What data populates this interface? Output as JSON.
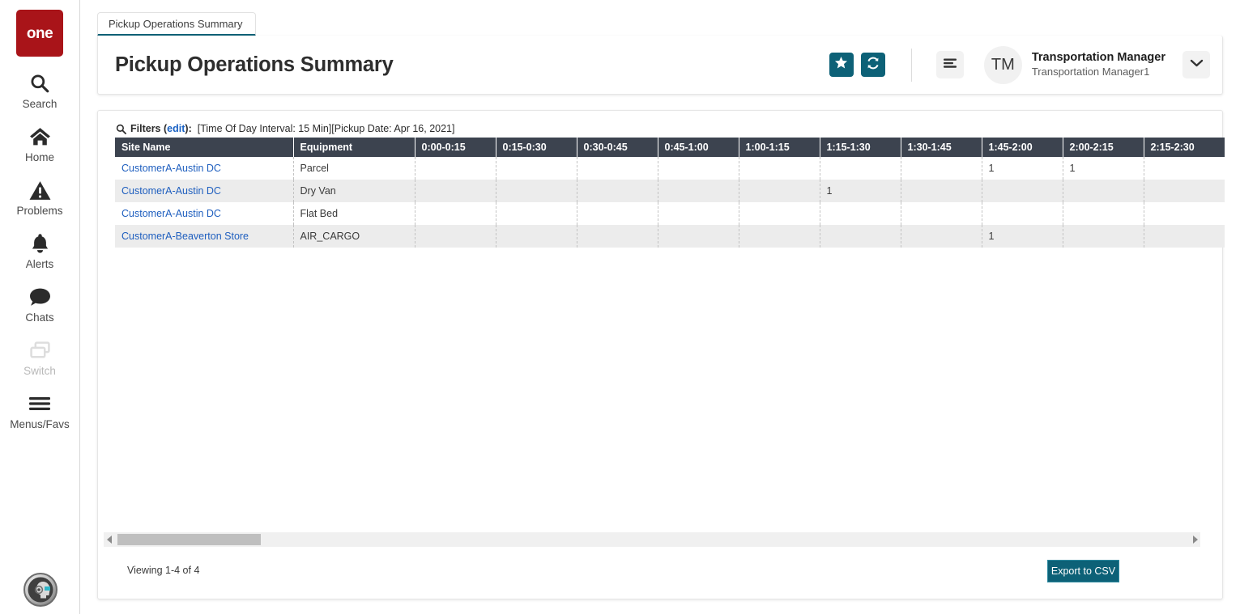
{
  "sidebar": {
    "logo_text": "one",
    "items": [
      {
        "label": "Search",
        "icon": "search-icon",
        "disabled": false
      },
      {
        "label": "Home",
        "icon": "home-icon",
        "disabled": false
      },
      {
        "label": "Problems",
        "icon": "warning-icon",
        "disabled": false
      },
      {
        "label": "Alerts",
        "icon": "bell-icon",
        "disabled": false
      },
      {
        "label": "Chats",
        "icon": "chat-icon",
        "disabled": false
      },
      {
        "label": "Switch",
        "icon": "switch-icon",
        "disabled": true
      },
      {
        "label": "Menus/Favs",
        "icon": "hamburger-icon",
        "disabled": false
      }
    ],
    "assistant_icon": "ai-assistant-avatar-icon"
  },
  "tab": {
    "label": "Pickup Operations Summary"
  },
  "header": {
    "title": "Pickup Operations Summary",
    "favorite_icon": "star-icon",
    "refresh_icon": "refresh-icon",
    "menu_icon": "hamburger-icon",
    "avatar_initials": "TM",
    "user_name": "Transportation Manager",
    "user_subtitle": "Transportation Manager1",
    "dropdown_icon": "chevron-down-icon"
  },
  "filters": {
    "icon": "search-icon",
    "label": "Filters",
    "edit_label": "edit",
    "colon": ":",
    "value": "[Time Of Day Interval: 15 Min][Pickup Date: Apr 16, 2021]"
  },
  "table": {
    "columns": [
      "Site Name",
      "Equipment",
      "0:00-0:15",
      "0:15-0:30",
      "0:30-0:45",
      "0:45-1:00",
      "1:00-1:15",
      "1:15-1:30",
      "1:30-1:45",
      "1:45-2:00",
      "2:00-2:15",
      "2:15-2:30"
    ],
    "rows": [
      {
        "site": "CustomerA-Austin DC",
        "equipment": "Parcel",
        "slots": [
          "",
          "",
          "",
          "",
          "",
          "",
          "",
          "1",
          "1",
          ""
        ]
      },
      {
        "site": "CustomerA-Austin DC",
        "equipment": "Dry Van",
        "slots": [
          "",
          "",
          "",
          "",
          "",
          "1",
          "",
          "",
          "",
          ""
        ]
      },
      {
        "site": "CustomerA-Austin DC",
        "equipment": "Flat Bed",
        "slots": [
          "",
          "",
          "",
          "",
          "",
          "",
          "",
          "",
          "",
          ""
        ]
      },
      {
        "site": "CustomerA-Beaverton Store",
        "equipment": "AIR_CARGO",
        "slots": [
          "",
          "",
          "",
          "",
          "",
          "",
          "",
          "1",
          "",
          ""
        ]
      }
    ]
  },
  "footer": {
    "viewing": "Viewing 1-4 of 4",
    "export_label": "Export to CSV",
    "scroll_left_icon": "triangle-left-icon",
    "scroll_right_icon": "triangle-right-icon"
  },
  "colors": {
    "brand_red": "#a91419",
    "teal": "#0d6177",
    "header_dark": "#3c434f",
    "link_blue": "#1f5fbf",
    "row_alt": "#ececec"
  }
}
